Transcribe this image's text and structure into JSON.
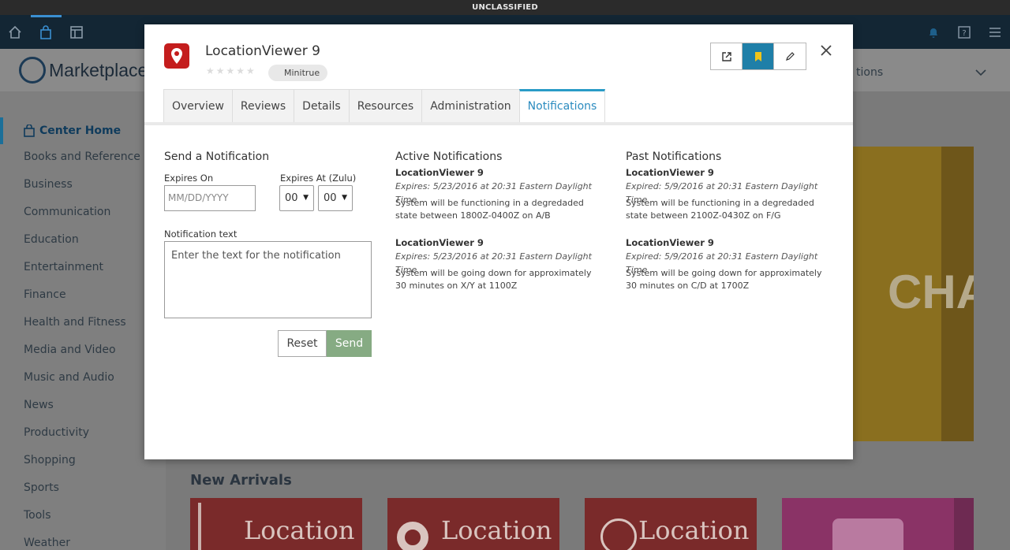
{
  "banner": "UNCLASSIFIED",
  "background": {
    "brand": "Marketplace",
    "right_text": "tions",
    "sidebar_home": "Center Home",
    "categories": [
      "Books and Reference",
      "Business",
      "Communication",
      "Education",
      "Entertainment",
      "Finance",
      "Health and Fitness",
      "Media and Video",
      "Music and Audio",
      "News",
      "Productivity",
      "Shopping",
      "Sports",
      "Tools",
      "Weather"
    ],
    "featured_text": "CHA",
    "new_arrivals": "New Arrivals",
    "tiles": [
      "Location",
      "Location",
      "Location"
    ]
  },
  "modal": {
    "app_title": "LocationViewer 9",
    "stars": "★★★★★",
    "rating": 0,
    "org": "Minitrue",
    "tabs": [
      "Overview",
      "Reviews",
      "Details",
      "Resources",
      "Administration",
      "Notifications"
    ],
    "active_tab": "Notifications",
    "send": {
      "title": "Send a Notification",
      "expires_on_label": "Expires On",
      "expires_on_placeholder": "MM/DD/YYYY",
      "expires_at_label": "Expires At (Zulu)",
      "hour": "00",
      "minute": "00",
      "text_label": "Notification text",
      "text_placeholder": "Enter the text for the notification",
      "reset": "Reset",
      "send": "Send"
    },
    "active": {
      "title": "Active Notifications",
      "items": [
        {
          "name": "LocationViewer 9",
          "expires": "Expires: 5/23/2016 at 20:31 Eastern Daylight Time",
          "message": "System will be functioning in a degredaded state between 1800Z-0400Z on A/B"
        },
        {
          "name": "LocationViewer 9",
          "expires": "Expires: 5/23/2016 at 20:31 Eastern Daylight Time",
          "message": "System will be going down for approximately 30 minutes on X/Y at 1100Z"
        }
      ]
    },
    "past": {
      "title": "Past Notifications",
      "items": [
        {
          "name": "LocationViewer 9",
          "expires": "Expired: 5/9/2016 at 20:31 Eastern Daylight Time",
          "message": "System will be functioning in a degredaded state between 2100Z-0430Z on F/G"
        },
        {
          "name": "LocationViewer 9",
          "expires": "Expired: 5/9/2016 at 20:31 Eastern Daylight Time",
          "message": "System will be going down for approximately 30 minutes on C/D at 1700Z"
        }
      ]
    }
  },
  "colors": {
    "accent": "#2a9bc7",
    "bookmark_active": "#1f7fa8",
    "send_button": "#86ab83",
    "app_icon": "#c41d1d"
  }
}
